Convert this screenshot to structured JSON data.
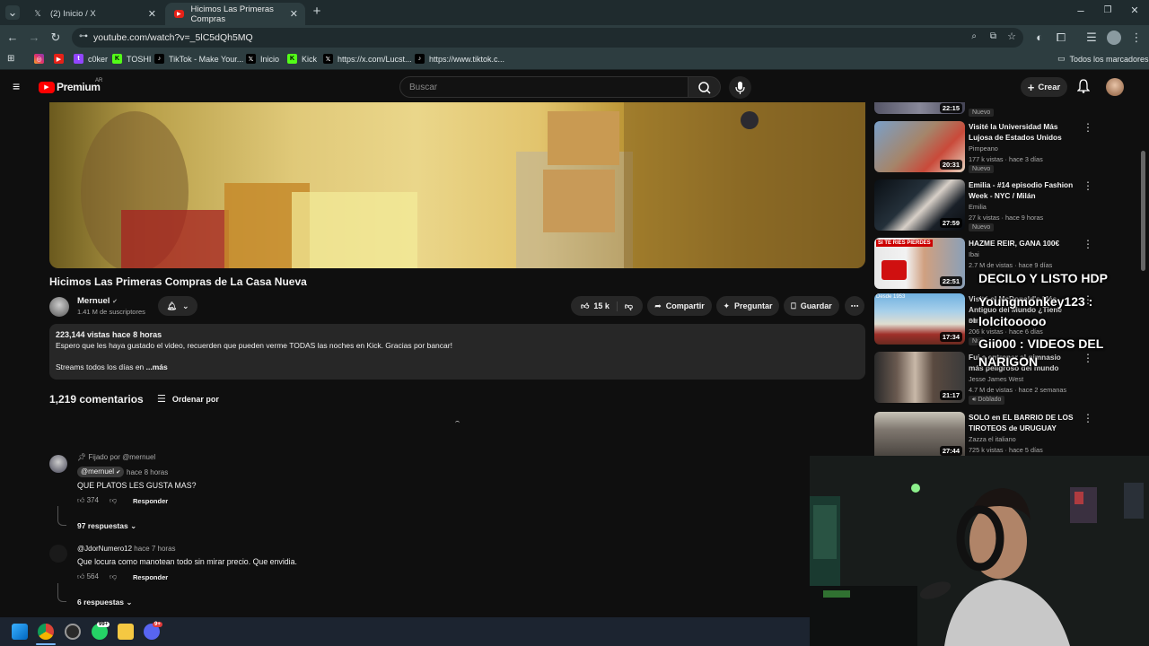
{
  "browser": {
    "tabs": [
      {
        "title": "(2) Inicio / X",
        "icon": "x-logo-icon",
        "active": false
      },
      {
        "title": "Hicimos Las Primeras Compras",
        "icon": "youtube-logo-icon",
        "active": true
      }
    ],
    "url": "youtube.com/watch?v=_5lC5dQh5MQ",
    "bookmarks": [
      {
        "label": "",
        "icon": "instagram-icon"
      },
      {
        "label": "",
        "icon": "youtube-icon"
      },
      {
        "label": "c0ker",
        "icon": "twitch-icon"
      },
      {
        "label": "TOSHI",
        "icon": "kick-icon"
      },
      {
        "label": "TikTok - Make Your...",
        "icon": "tiktok-icon"
      },
      {
        "label": "Inicio",
        "icon": "x-icon"
      },
      {
        "label": "Kick",
        "icon": "kick-icon"
      },
      {
        "label": "https://x.com/Lucst...",
        "icon": "x-icon"
      },
      {
        "label": "https://www.tiktok.c...",
        "icon": "tiktok-icon"
      }
    ],
    "all_bookmarks": "Todos los marcadores"
  },
  "yt": {
    "logo": "Premium",
    "region": "AR",
    "search_placeholder": "Buscar",
    "create": "Crear"
  },
  "video": {
    "title": "Hicimos Las Primeras Compras de La Casa Nueva",
    "channel": "Mernuel",
    "subscribers": "1.41 M de suscriptores",
    "likes": "15 k",
    "share": "Compartir",
    "ask": "Preguntar",
    "save": "Guardar",
    "desc_stats": "223,144 vistas  hace 8 horas",
    "desc_line": "Espero que les haya gustado el video, recuerden que pueden verme TODAS las noches en Kick. Gracias por bancar!",
    "desc_line2": "Streams todos los días en",
    "more": "...más"
  },
  "comments": {
    "count": "1,219 comentarios",
    "sort": "Ordenar por",
    "items": [
      {
        "pinned": "Fijado por @mernuel",
        "author": "@mernuel",
        "time": "hace 8 horas",
        "text": "QUE PLATOS LES GUSTA MAS?",
        "likes": "374",
        "reply": "Responder",
        "replies": "97 respuestas"
      },
      {
        "author": "@JdorNumero12",
        "time": "hace 7 horas",
        "text": "Que locura como manotean todo sin mirar precio. Que envidia.",
        "likes": "564",
        "reply": "Responder",
        "replies": "6 respuestas"
      }
    ]
  },
  "sidebar": [
    {
      "title": "",
      "channel": "",
      "meta": "",
      "badge": "Nuevo",
      "duration": "22:15"
    },
    {
      "title": "Visité la Universidad Más Lujosa de Estados Unidos",
      "channel": "Pimpeano",
      "meta": "177 k vistas · hace 3 días",
      "badge": "Nuevo",
      "duration": "20:31"
    },
    {
      "title": "Emilia - #14 episodio Fashion Week - NYC / Milán",
      "channel": "Emilia",
      "meta": "27 k vistas · hace 9 horas",
      "badge": "Nuevo",
      "duration": "27:59"
    },
    {
      "title": "HAZME REIR, GANA 100€",
      "channel": "Ibai",
      "meta": "2.7 M de vistas · hace 9 días",
      "badge": "",
      "duration": "22:51"
    },
    {
      "title": "Visité el McDonald's Más Antiguo del Mundo ¿Tiene otr...",
      "channel": "Pim",
      "meta": "206 k vistas · hace 6 días",
      "badge": "Nu",
      "duration": "17:34"
    },
    {
      "title": "Fui a entrenar al gimnasio más peligroso del mundo",
      "channel": "Jesse James West",
      "meta": "4.7 M de vistas · hace 2 semanas",
      "badge": "Doblado",
      "duration": "21:17"
    },
    {
      "title": "SOLO en EL BARRIO DE LOS TIROTEOS de URUGUAY",
      "channel": "Zazza el italiano",
      "meta": "725 k vistas · hace 5 días",
      "badge": "",
      "duration": "27:44"
    }
  ],
  "overlay": {
    "line1": "DECILO Y LISTO HDP",
    "line2": "Youngmonkey123 :",
    "line3": "lolcitooooo",
    "line4": "Gii000 : VIDEOS DEL",
    "line5": "NARIGON"
  },
  "taskbar_badges": [
    "99+",
    "9+"
  ]
}
